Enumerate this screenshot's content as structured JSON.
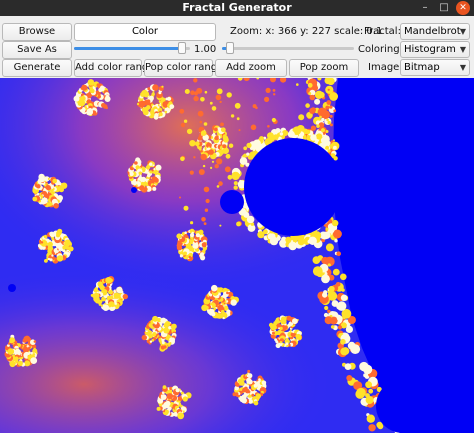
{
  "window": {
    "title": "Fractal Generator",
    "minimize_glyph": "–",
    "maximize_glyph": "□",
    "close_glyph": "✕"
  },
  "toolbar": {
    "browse_label": "Browse",
    "color_value": "Color",
    "save_as_label": "Save As",
    "generate_label": "Generate",
    "add_color_range_label": "Add color range",
    "pop_color_range_label": "Pop color range",
    "add_zoom_label": "Add zoom",
    "pop_zoom_label": "Pop zoom",
    "zoom_readout": "Zoom: x: 366 y: 227 scale: 0.1",
    "slider_value_label": "1.00",
    "color_slider_fraction": 0.96,
    "second_slider_fraction": 0.03,
    "fractal_label": "Fractal:",
    "fractal_value": "Mandelbrot",
    "coloring_label": "Coloring:",
    "coloring_value": "Histogram",
    "image_label": "Image:",
    "image_value": "Bitmap"
  },
  "colors": {
    "fractal_background": "#2f2cf2",
    "fractal_inner_set": "#0000f5",
    "fractal_orange": "#ff6b2f",
    "fractal_yellow": "#ffe22a",
    "fractal_white": "#fffbe0",
    "slider_accent": "#3d8ee6",
    "close_button": "#e95420"
  }
}
